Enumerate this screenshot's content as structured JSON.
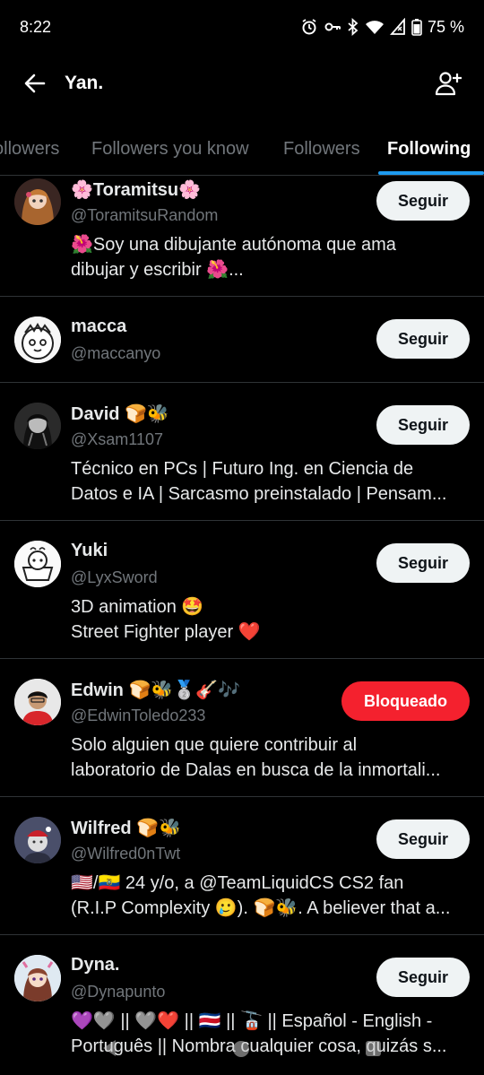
{
  "status_bar": {
    "time": "8:22",
    "battery": "75 %"
  },
  "header": {
    "title": "Yan."
  },
  "tabs": [
    {
      "label": "Verified Followers",
      "visible_label": "ollowers"
    },
    {
      "label": "Followers you know"
    },
    {
      "label": "Followers"
    },
    {
      "label": "Following",
      "active": true
    }
  ],
  "users": [
    {
      "name": "🌸Toramitsu🌸",
      "handle": "@ToramitsuRandom",
      "bio": [
        "🌺Soy una dibujante autónoma que ama",
        "dibujar y escribir 🌺..."
      ],
      "button": "Seguir"
    },
    {
      "name": "macca",
      "handle": "@maccanyo",
      "bio": [],
      "button": "Seguir"
    },
    {
      "name": "David 🍞🐝",
      "handle": "@Xsam1107",
      "bio": [
        "Técnico en PCs | Futuro Ing. en Ciencia  de",
        "Datos e IA | Sarcasmo preinstalado | Pensam..."
      ],
      "button": "Seguir"
    },
    {
      "name": "Yuki",
      "handle": "@LyxSword",
      "bio": [
        "3D animation 🤩",
        "Street Fighter player ❤️"
      ],
      "button": "Seguir"
    },
    {
      "name": "Edwin 🍞🐝🥈🎸🎶",
      "handle": "@EdwinToledo233",
      "bio": [
        "Solo alguien que quiere contribuir al",
        "laboratorio de Dalas en busca de la inmortali..."
      ],
      "button": "Bloqueado"
    },
    {
      "name": "Wilfred 🍞🐝",
      "handle": "@Wilfred0nTwt",
      "bio": [
        "🇺🇸/🇪🇨  24 y/o, a @TeamLiquidCS CS2 fan",
        "(R.I.P Complexity 🥲). 🍞🐝. A believer that a..."
      ],
      "button": "Seguir"
    },
    {
      "name": "Dyna.",
      "handle": "@Dynapunto",
      "bio": [
        "💜🩶 || 🩶❤️ || 🇨🇷 || 🚡 || Español - English -",
        "Português || Nombra cualquier cosa, quizás s..."
      ],
      "button": "Seguir"
    }
  ],
  "colors": {
    "accent": "#1d9bf0",
    "danger": "#f4212e",
    "background": "#000000",
    "secondary_text": "#71767b"
  }
}
